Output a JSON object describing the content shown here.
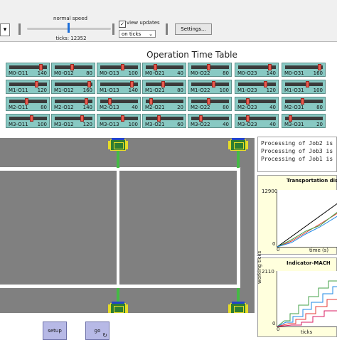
{
  "toolbar": {
    "left_dropdown_glyph": "▾",
    "speed_label": "normal speed",
    "speed_fraction": 0.5,
    "ticks_label": "ticks: 12352",
    "view_updates_label": "view updates",
    "view_updates_checked": true,
    "update_mode": "on ticks",
    "settings_label": "Settings..."
  },
  "table": {
    "title": "Operation Time Table",
    "rows": [
      [
        {
          "label": "M0-O11",
          "value": "140",
          "pos": 0.88
        },
        {
          "label": "M0-O12",
          "value": "80",
          "pos": 0.45
        },
        {
          "label": "M0-O13",
          "value": "100",
          "pos": 0.6
        },
        {
          "label": "M0-O21",
          "value": "40",
          "pos": 0.22
        },
        {
          "label": "M0-O22",
          "value": "80",
          "pos": 0.45
        },
        {
          "label": "M0-O23",
          "value": "140",
          "pos": 0.88
        },
        {
          "label": "M0-O31",
          "value": "160",
          "pos": 0.96
        }
      ],
      [
        {
          "label": "M1-O11",
          "value": "120",
          "pos": 0.75
        },
        {
          "label": "M1-O12",
          "value": "160",
          "pos": 0.96
        },
        {
          "label": "M1-O13",
          "value": "140",
          "pos": 0.88
        },
        {
          "label": "M1-O21",
          "value": "80",
          "pos": 0.45
        },
        {
          "label": "M1-O22",
          "value": "100",
          "pos": 0.6
        },
        {
          "label": "M1-O23",
          "value": "120",
          "pos": 0.75
        },
        {
          "label": "M1-O31",
          "value": "100",
          "pos": 0.6
        }
      ],
      [
        {
          "label": "M2-O11",
          "value": "80",
          "pos": 0.45
        },
        {
          "label": "M2-O12",
          "value": "140",
          "pos": 0.88
        },
        {
          "label": "M2-O13",
          "value": "40",
          "pos": 0.22
        },
        {
          "label": "M2-O21",
          "value": "20",
          "pos": 0.1
        },
        {
          "label": "M2-O22",
          "value": "80",
          "pos": 0.45
        },
        {
          "label": "M2-O23",
          "value": "40",
          "pos": 0.22
        },
        {
          "label": "M2-O31",
          "value": "80",
          "pos": 0.45
        }
      ],
      [
        {
          "label": "M3-O11",
          "value": "100",
          "pos": 0.6
        },
        {
          "label": "M3-O12",
          "value": "120",
          "pos": 0.75
        },
        {
          "label": "M3-O13",
          "value": "100",
          "pos": 0.6
        },
        {
          "label": "M3-O21",
          "value": "60",
          "pos": 0.34
        },
        {
          "label": "M3-O22",
          "value": "40",
          "pos": 0.22
        },
        {
          "label": "M3-O23",
          "value": "40",
          "pos": 0.22
        },
        {
          "label": "M3-O31",
          "value": "20",
          "pos": 0.1
        }
      ]
    ]
  },
  "buttons": {
    "setup": "setup",
    "go": "go",
    "go_forever_glyph": "↻"
  },
  "output": {
    "lines": [
      "Processing of Job2 is",
      "Processing of Job3 is",
      "Processing of Job1 is"
    ]
  },
  "plot1": {
    "title": "Transportation dis",
    "ymax": "12900",
    "ymin": "0",
    "xmin": "0",
    "xlabel": "time (s)"
  },
  "plot2": {
    "title": "Indicator-MACH",
    "ymax": "2110",
    "ymin": "0",
    "xmin": "0",
    "ylabel": "working ticks",
    "xlabel": "ticks"
  },
  "colors": {
    "slider_bg": "#88c9c3",
    "slider_knob": "#e85a4f",
    "world_bg": "#808080",
    "button_bg": "#b7b9e6",
    "plot_bg": "#ffffdd"
  },
  "icons": [
    "dropdown-arrow-icon",
    "checkbox-icon",
    "chevron-down-icon",
    "forever-icon",
    "machine-icon"
  ]
}
